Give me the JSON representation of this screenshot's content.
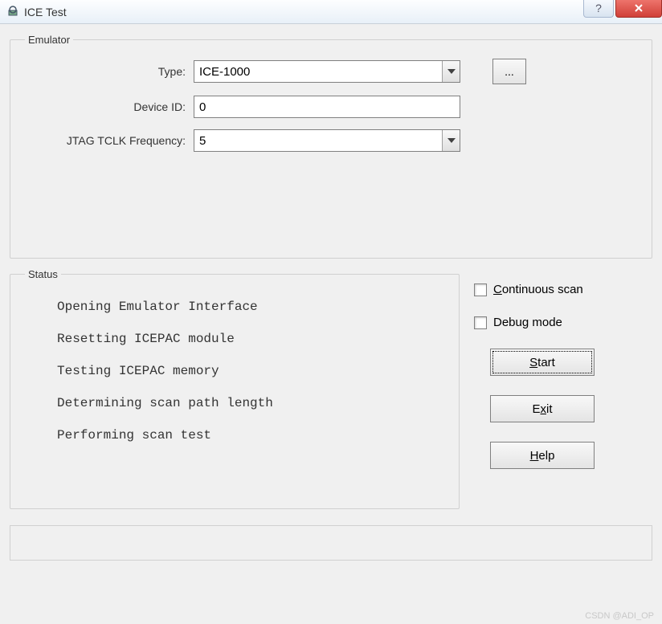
{
  "window": {
    "title": "ICE Test"
  },
  "emulator": {
    "legend": "Emulator",
    "type_label": "Type:",
    "type_value": "ICE-1000",
    "device_id_label": "Device ID:",
    "device_id_value": "0",
    "jtag_label": "JTAG TCLK Frequency:",
    "jtag_value": "5",
    "browse_label": "..."
  },
  "status": {
    "legend": "Status",
    "items": [
      "Opening Emulator Interface",
      "Resetting ICEPAC module",
      "Testing ICEPAC memory",
      "Determining scan path length",
      "Performing scan test"
    ]
  },
  "options": {
    "continuous_scan_prefix": "C",
    "continuous_scan_rest": "ontinuous scan",
    "debug_mode": "Debug mode"
  },
  "actions": {
    "start_prefix": "S",
    "start_rest": "tart",
    "exit_prefix": "E",
    "exit_mid": "x",
    "exit_rest": "it",
    "help_prefix": "H",
    "help_rest": "elp"
  },
  "watermark": "CSDN @ADI_OP"
}
